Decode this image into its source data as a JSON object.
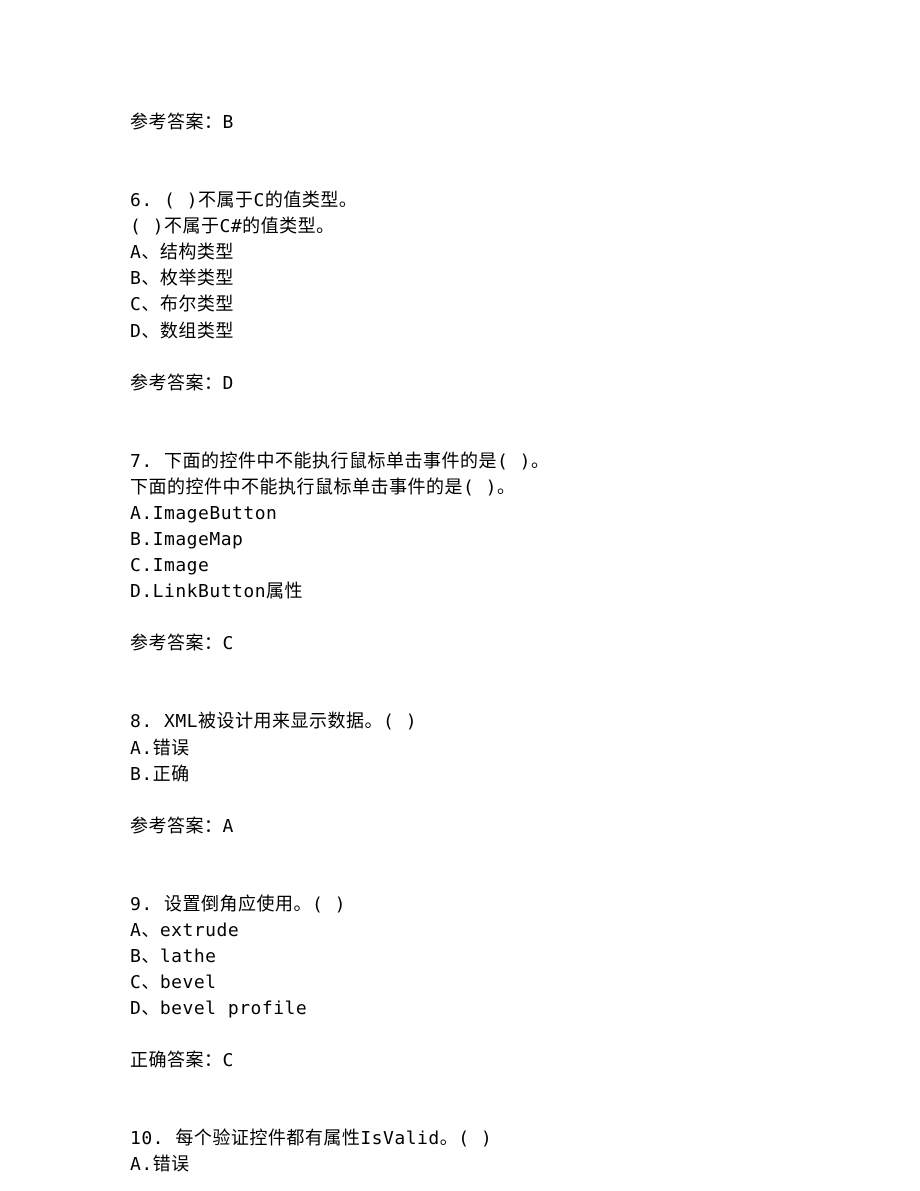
{
  "top_answer": "参考答案：B",
  "q6": {
    "title": "6. (  )不属于C的值类型。",
    "repeat": "(  )不属于C#的值类型。",
    "a": "A、结构类型",
    "b": "B、枚举类型",
    "c": "C、布尔类型",
    "d": "D、数组类型",
    "answer": "参考答案：D"
  },
  "q7": {
    "title": "7. 下面的控件中不能执行鼠标单击事件的是(  )。",
    "repeat": "下面的控件中不能执行鼠标单击事件的是(  )。",
    "a": "A.ImageButton",
    "b": "B.ImageMap",
    "c": "C.Image",
    "d": "D.LinkButton属性",
    "answer": "参考答案：C"
  },
  "q8": {
    "title": "8. XML被设计用来显示数据。(  )",
    "a": "A.错误",
    "b": "B.正确",
    "answer": "参考答案：A"
  },
  "q9": {
    "title": "9. 设置倒角应使用。( )",
    "a": "A、extrude",
    "b": "B、lathe",
    "c": "C、bevel",
    "d": "D、bevel profile",
    "answer": "正确答案：C"
  },
  "q10": {
    "title": "10. 每个验证控件都有属性IsValid。(  )",
    "a": "A.错误"
  }
}
